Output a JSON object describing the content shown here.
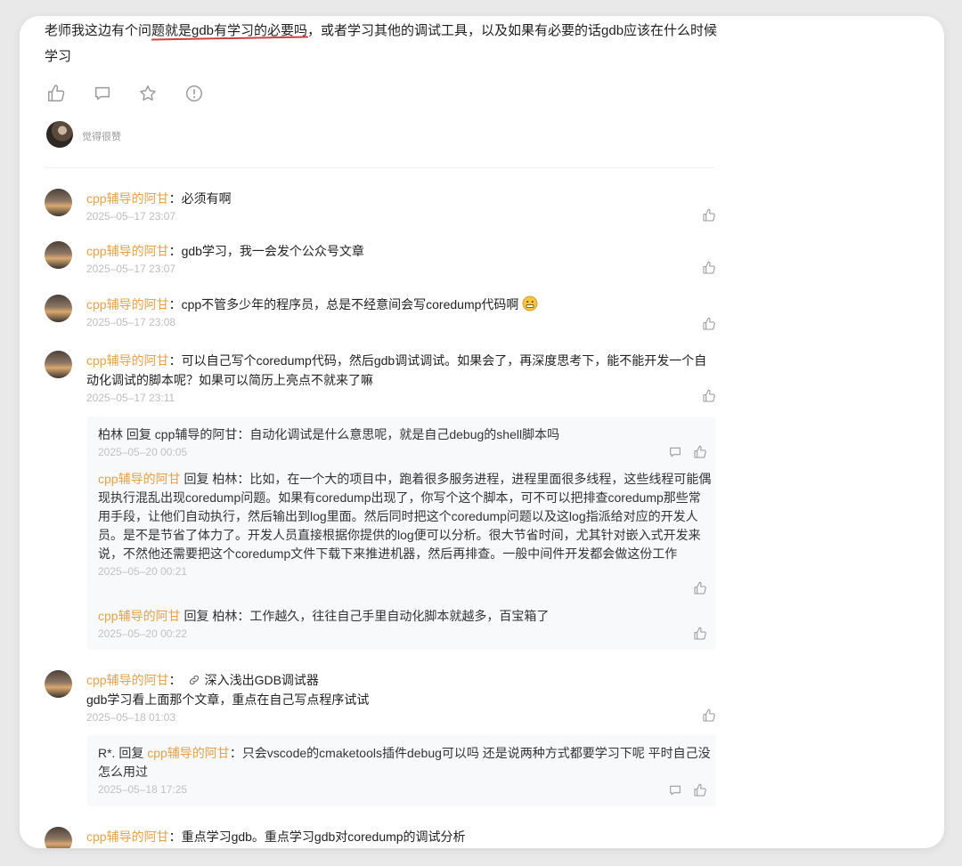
{
  "question": {
    "text": "老师我这边有个问题就是gdb有学习的必要吗，或者学习其他的调试工具，以及如果有必要的话gdb应该在什么时候学习"
  },
  "actions": [
    {
      "name": "like-icon"
    },
    {
      "name": "comment-icon"
    },
    {
      "name": "star-icon"
    },
    {
      "name": "report-icon"
    }
  ],
  "liker": {
    "text": "觉得很赞"
  },
  "comments": [
    {
      "user": "cpp辅导的阿甘",
      "text": "必须有啊",
      "time": "2025–05–17 23:07"
    },
    {
      "user": "cpp辅导的阿甘",
      "text": "gdb学习，我一会发个公众号文章",
      "time": "2025–05–17 23:07"
    },
    {
      "user": "cpp辅导的阿甘",
      "text": "cpp不管多少年的程序员，总是不经意间会写coredump代码啊",
      "emoji": "grimace-emoji",
      "time": "2025–05–17 23:08"
    },
    {
      "user": "cpp辅导的阿甘",
      "text": "可以自己写个coredump代码，然后gdb调试调试。如果会了，再深度思考下，能不能开发一个自动化调试的脚本呢？如果可以简历上亮点不就来了嘛",
      "time": "2025–05–17 23:11",
      "replies": [
        {
          "from": "柏林",
          "reply_word": "回复",
          "to": "cpp辅导的阿甘",
          "text": "自动化调试是什么意思呢，就是自己debug的shell脚本吗",
          "time": "2025–05–20 00:05"
        },
        {
          "from": "cpp辅导的阿甘",
          "reply_word": "回复",
          "to": "柏林",
          "text": "比如，在一个大的项目中，跑着很多服务进程，进程里面很多线程，这些线程可能偶现执行混乱出现coredump问题。如果有coredump出现了，你写个这个脚本，可不可以把排查coredump那些常用手段，让他们自动执行，然后输出到log里面。然后同时把这个coredump问题以及这log指派给对应的开发人员。是不是节省了体力了。开发人员直接根据你提供的log便可以分析。很大节省时间，尤其针对嵌入式开发来说，不然他还需要把这个coredump文件下载下来推进机器，然后再排查。一般中间件开发都会做这份工作",
          "time": "2025–05–20 00:21"
        },
        {
          "from": "cpp辅导的阿甘",
          "reply_word": "回复",
          "to": "柏林",
          "text": "工作越久，往往自己手里自动化脚本就越多，百宝箱了",
          "time": "2025–05–20 00:22"
        }
      ]
    },
    {
      "user": "cpp辅导的阿甘",
      "link": "深入浅出GDB调试器",
      "text": "gdb学习看上面那个文章，重点在自己写点程序试试",
      "time": "2025–05–18 01:03",
      "replies": [
        {
          "from": "R*.",
          "reply_word": "回复",
          "to": "cpp辅导的阿甘",
          "text": "只会vscode的cmaketools插件debug可以吗 还是说两种方式都要学习下呢 平时自己没怎么用过",
          "time": "2025–05–18 17:25"
        }
      ]
    },
    {
      "user": "cpp辅导的阿甘",
      "text": "重点学习gdb。重点学习gdb对coredump的调试分析"
    }
  ],
  "colors": {
    "username": "#e3a24b",
    "timestamp": "#bdbdbd",
    "reply_bg": "#f7f9fb",
    "underline": "#d23f3f"
  }
}
